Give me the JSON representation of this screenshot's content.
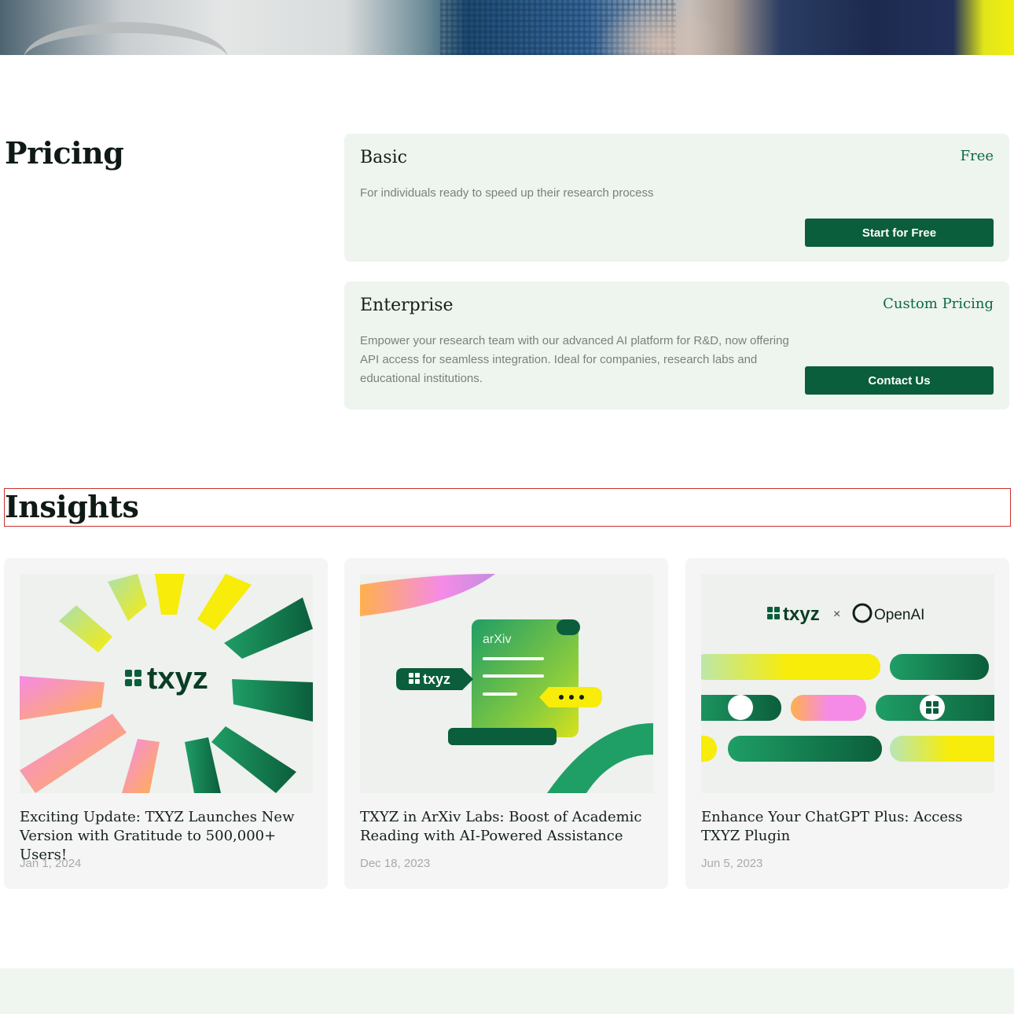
{
  "pricing": {
    "heading": "Pricing",
    "plans": [
      {
        "name": "Basic",
        "price": "Free",
        "description": "For individuals ready to speed up their research process",
        "button": "Start for Free"
      },
      {
        "name": "Enterprise",
        "price": "Custom Pricing",
        "description": "Empower your research team with our advanced AI platform for R&D, now offering API access for seamless integration. Ideal for companies, research labs and educational institutions.",
        "button": "Contact Us"
      }
    ]
  },
  "insights": {
    "heading": "Insights",
    "cards": [
      {
        "title": "Exciting Update: TXYZ Launches New Version with Gratitude to 500,000+ Users!",
        "date": "Jan 1, 2024",
        "thumb_logo": "txyz"
      },
      {
        "title": "TXYZ in ArXiv Labs: Boost of Academic Reading with AI-Powered Assistance",
        "date": "Dec 18, 2023",
        "thumb_logo": "txyz",
        "thumb_doc": "arXiv"
      },
      {
        "title": "Enhance Your ChatGPT Plus: Access TXYZ Plugin",
        "date": "Jun 5, 2023",
        "thumb_logo": "txyz",
        "thumb_times": "×",
        "thumb_partner": "OpenAI"
      }
    ]
  },
  "colors": {
    "brand_green": "#0b5e3b",
    "price_green": "#0b6a43",
    "plan_bg": "#eef4ee",
    "card_bg": "#f5f5f5",
    "accent_yellow": "#f7ec0a",
    "accent_pink": "#f58be6"
  }
}
